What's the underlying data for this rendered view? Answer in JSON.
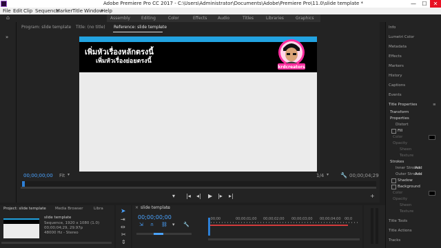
{
  "window": {
    "title": "Adobe Premiere Pro CC 2017 - C:\\Users\\Administrator\\Documents\\Adobe\\Premiere Pro\\11.0\\slide template *",
    "minimize": "—",
    "maximize": "☐",
    "close": "✕"
  },
  "menu": [
    "File",
    "Edit",
    "Clip",
    "Sequence",
    "Marker",
    "Title",
    "Window",
    "Help"
  ],
  "workspaces": [
    "Assembly",
    "Editing",
    "Color",
    "Effects",
    "Audio",
    "Titles",
    "Libraries",
    "Graphics"
  ],
  "monitor": {
    "tabs": [
      "Program: slide template",
      "Title: (no title)",
      "Reference: slide template"
    ],
    "title_text_1": "เพิ่มหัวเรื่องหลักตรงนี้",
    "title_text_2": "เพิ่มหัวเรื่องย่อยตรงนี้",
    "logo_text": "krdcreators",
    "timecode_left": "00;00;00;00",
    "fit": "Fit",
    "fraction": "1/4",
    "timecode_right": "00;00;04;29"
  },
  "right_panel": {
    "items": [
      "Info",
      "Lumetri Color",
      "Metadata",
      "Effects",
      "Markers",
      "History",
      "Captions",
      "Events"
    ],
    "title_properties": "Title Properties",
    "transform": "Transform",
    "properties": "Properties",
    "distort": "Distort",
    "fill": "Fill",
    "color": "Color",
    "opacity": "Opacity",
    "sheen": "Sheen",
    "texture": "Texture",
    "strokes": "Strokes",
    "inner_strokes": "Inner Strokes",
    "outer_strokes": "Outer Strokes",
    "add": "Add",
    "shadow": "Shadow",
    "background": "Background",
    "bottom_items": [
      "Title Tools",
      "Title Actions",
      "Tracks"
    ]
  },
  "project": {
    "tabs": [
      "Project: slide template",
      "Media Browser",
      "Libra"
    ],
    "seq_name": "slide template",
    "seq_info_1": "Sequence, 1920 x 1080 (1.0)",
    "seq_info_2": "00;00;04;29, 29.97p",
    "seq_info_3": "48000 Hz - Stereo"
  },
  "timeline": {
    "tab": "slide template",
    "timecode": "00;00;00;00",
    "ruler": [
      ":00;00",
      "00;00;01;00",
      "00;00;02;00",
      "00;00;03;00",
      "00;00;04;00",
      "00;0"
    ]
  },
  "colors": {
    "accent_blue": "#4aa3ff",
    "header_cyan": "#22a3e1",
    "playhead_blue": "#2d7fd6",
    "clip_red": "#d23c3c"
  }
}
